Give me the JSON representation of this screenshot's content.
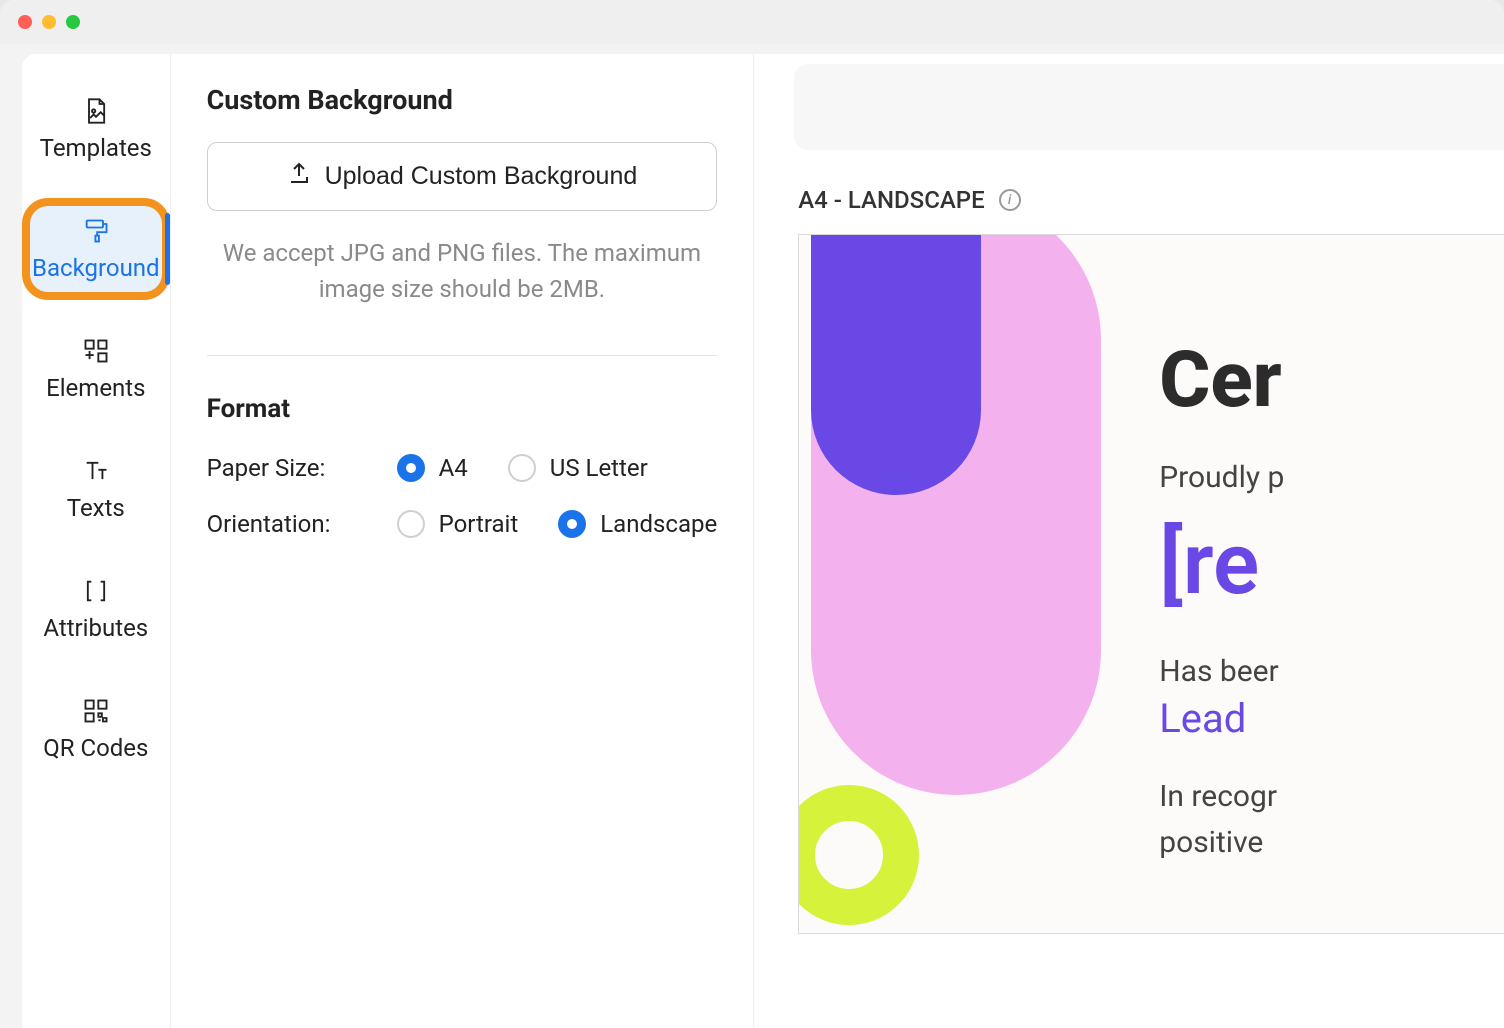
{
  "sidebar": {
    "items": [
      {
        "label": "Templates"
      },
      {
        "label": "Background"
      },
      {
        "label": "Elements"
      },
      {
        "label": "Texts"
      },
      {
        "label": "Attributes"
      },
      {
        "label": "QR Codes"
      }
    ]
  },
  "panel": {
    "custom_bg_title": "Custom Background",
    "upload_label": "Upload Custom Background",
    "hint": "We accept JPG and PNG files. The maximum image size should be 2MB.",
    "format_title": "Format",
    "paper_size_label": "Paper Size:",
    "paper_size_options": {
      "a4": "A4",
      "us_letter": "US Letter"
    },
    "orientation_label": "Orientation:",
    "orientation_options": {
      "portrait": "Portrait",
      "landscape": "Landscape"
    }
  },
  "preview": {
    "header": "A4 - LANDSCAPE",
    "certificate": {
      "title": "Cer",
      "subtitle": "Proudly p",
      "tag": "[re",
      "body1": "Has beer",
      "link": "Lead",
      "para1": "In recogr",
      "para2": "positive"
    }
  },
  "colors": {
    "accent": "#1a73e8",
    "highlight_ring": "#f3931d",
    "shape_purple": "#6a48e6",
    "shape_pink": "#f3b2ee",
    "shape_lime": "#d7f23a"
  }
}
